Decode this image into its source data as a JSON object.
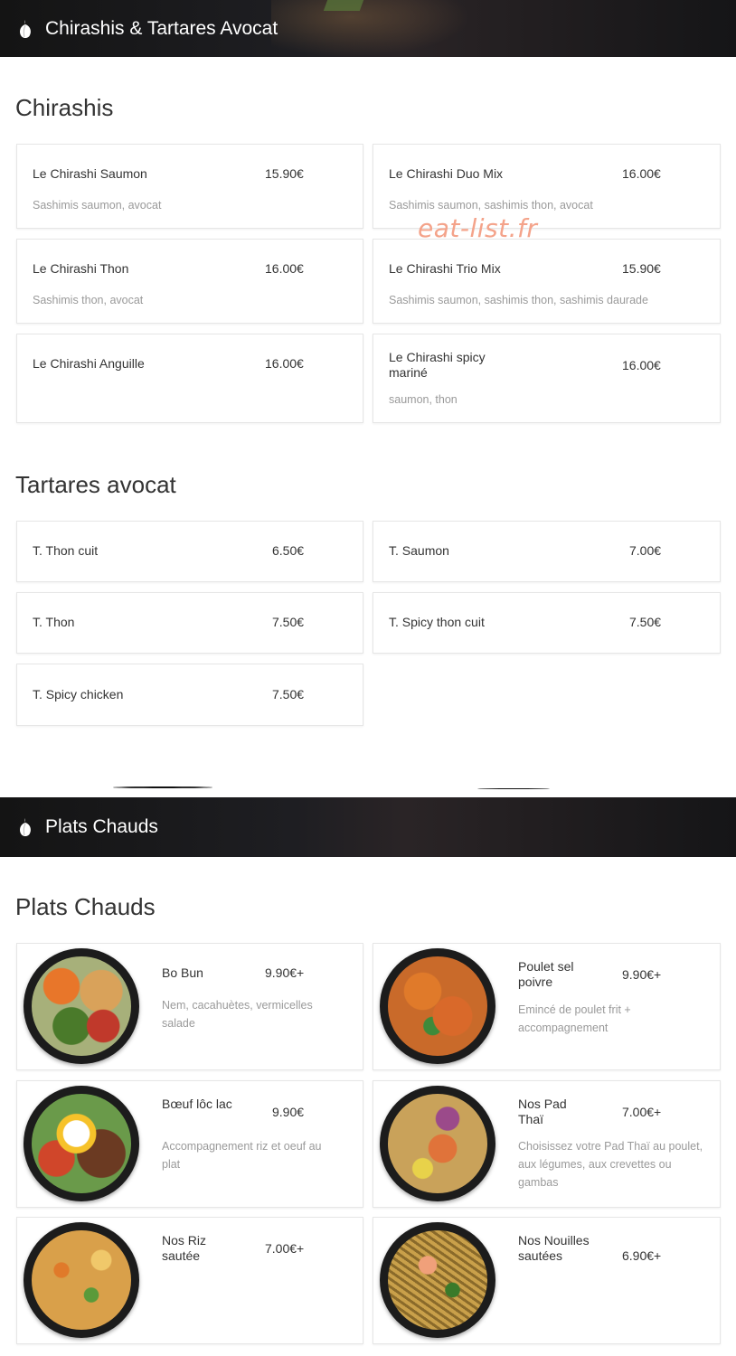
{
  "banners": [
    {
      "title": "Chirashis & Tartares Avocat",
      "icon": "garlic-icon"
    },
    {
      "title": "Plats Chauds",
      "icon": "garlic-icon"
    }
  ],
  "watermark": "eat-list.fr",
  "sections": {
    "chirashis": {
      "title": "Chirashis",
      "items": [
        {
          "name": "Le Chirashi Saumon",
          "price": "15.90€",
          "desc": "Sashimis saumon, avocat"
        },
        {
          "name": "Le Chirashi Duo Mix",
          "price": "16.00€",
          "desc": "Sashimis saumon, sashimis thon, avocat"
        },
        {
          "name": "Le Chirashi Thon",
          "price": "16.00€",
          "desc": "Sashimis thon, avocat"
        },
        {
          "name": "Le Chirashi Trio Mix",
          "price": "15.90€",
          "desc": "Sashimis saumon, sashimis thon, sashimis daurade"
        },
        {
          "name": "Le Chirashi Anguille",
          "price": "16.00€",
          "desc": ""
        },
        {
          "name": "Le Chirashi spicy mariné",
          "price": "16.00€",
          "desc": "saumon, thon"
        }
      ]
    },
    "tartares": {
      "title": "Tartares avocat",
      "items": [
        {
          "name": "T. Thon cuit",
          "price": "6.50€"
        },
        {
          "name": "T. Saumon",
          "price": "7.00€"
        },
        {
          "name": "T. Thon",
          "price": "7.50€"
        },
        {
          "name": "T. Spicy thon cuit",
          "price": "7.50€"
        },
        {
          "name": "T. Spicy chicken",
          "price": "7.50€"
        }
      ]
    },
    "plats": {
      "title": "Plats Chauds",
      "items": [
        {
          "name": "Bo Bun",
          "price": "9.90€+",
          "desc": "Nem, cacahuètes, vermicelles salade"
        },
        {
          "name": "Poulet sel poivre",
          "price": "9.90€+",
          "desc": "Emincé de poulet frit + accompagnement"
        },
        {
          "name": "Bœuf lôc lac",
          "price": "9.90€",
          "desc": "Accompagnement riz et oeuf au plat"
        },
        {
          "name": "Nos Pad Thaï",
          "price": "7.00€+",
          "desc": "Choisissez votre Pad Thaï au poulet, aux légumes, aux crevettes ou gambas"
        },
        {
          "name": "Nos Riz sautée",
          "price": "7.00€+",
          "desc": ""
        },
        {
          "name": "Nos Nouilles sautées",
          "price": "6.90€+",
          "desc": ""
        }
      ]
    }
  },
  "colors": {
    "banner": "#141414",
    "watermark": "#f4a38a",
    "muted": "#9a9a9a"
  }
}
